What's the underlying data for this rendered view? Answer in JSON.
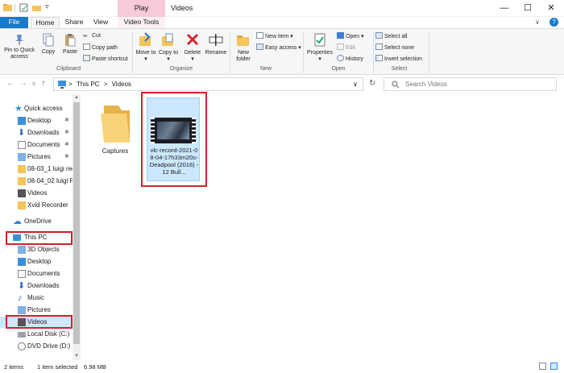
{
  "titlebar": {
    "context_tab": "Play",
    "title": "Videos",
    "minimize": "—",
    "maximize": "☐",
    "close": "✕"
  },
  "tabs": [
    "File",
    "Home",
    "Share",
    "View",
    "Video Tools"
  ],
  "ribbon": {
    "clipboard": {
      "pin": "Pin to Quick access",
      "copy": "Copy",
      "paste": "Paste",
      "cut": "Cut",
      "copy_path": "Copy path",
      "paste_shortcut": "Paste shortcut",
      "label": "Clipboard"
    },
    "organize": {
      "move_to": "Move to",
      "copy_to": "Copy to",
      "delete": "Delete",
      "rename": "Rename",
      "label": "Organize"
    },
    "new": {
      "new_folder": "New folder",
      "new_item": "New item",
      "easy_access": "Easy access",
      "label": "New"
    },
    "open": {
      "properties": "Properties",
      "open": "Open",
      "edit": "Edit",
      "history": "History",
      "label": "Open"
    },
    "select": {
      "select_all": "Select all",
      "select_none": "Select none",
      "invert": "Invert selection",
      "label": "Select"
    }
  },
  "address": {
    "path_root": "This PC",
    "path_sep": ">",
    "path_leaf": "Videos",
    "search_placeholder": "Search Videos"
  },
  "nav": {
    "quick_access": "Quick access",
    "quick_items": [
      "Desktop",
      "Downloads",
      "Documents",
      "Pictures",
      "08-03_1 luigi rec",
      "08-04_02 luigi Re",
      "Videos",
      "Xvid Recorder"
    ],
    "onedrive": "OneDrive",
    "this_pc": "This PC",
    "pc_items": [
      "3D Objects",
      "Desktop",
      "Documents",
      "Downloads",
      "Music",
      "Pictures",
      "Videos",
      "Local Disk (C:)",
      "DVD Drive (D:) P"
    ]
  },
  "files": [
    {
      "name": "Captures"
    },
    {
      "name": "vlc-record-2021-08-04-17h33m20s-Deadpool (2016) - 12 Bull..."
    }
  ],
  "status": {
    "items": "2 items",
    "selected": "1 item selected",
    "size": "6.98 MB"
  },
  "colors": {
    "accent": "#1979ca",
    "highlight": "#d1212a",
    "selection": "#cce8ff",
    "folder": "#f3c55b"
  }
}
